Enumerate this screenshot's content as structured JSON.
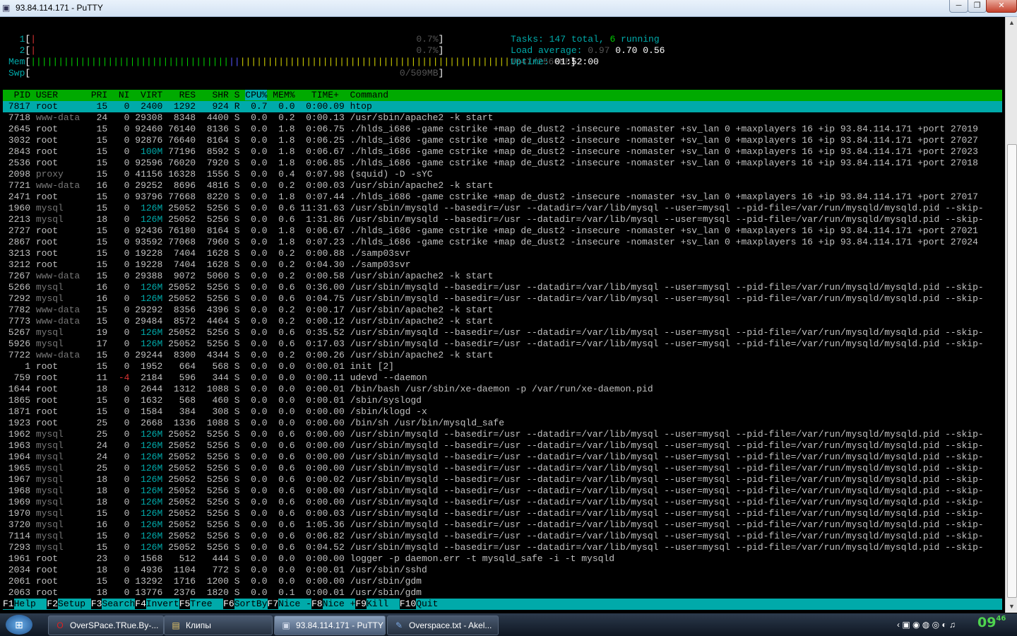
{
  "window": {
    "title": "93.84.114.171 - PuTTY",
    "min": "─",
    "max": "❐",
    "close": "✕"
  },
  "colors": {
    "bg": "#000000",
    "fg": "#c0c0c0",
    "cyan": "#00aaaa",
    "green": "#00c000",
    "bright_green": "#00cc00",
    "white": "#ffffff",
    "yellow": "#d0d000",
    "blue": "#5555ff",
    "red": "#dd3333",
    "grey": "#777777",
    "header_bg": "#00aa00",
    "select_bg": "#00aaaa",
    "fkey_bg": "#00aaaa"
  },
  "meters": [
    {
      "label": "1",
      "bar": "|",
      "value": "0.7%"
    },
    {
      "label": "2",
      "bar": "|",
      "value": "0.7%"
    },
    {
      "label": "Mem",
      "bar": "|||||||||||||||||||||||||||||||||||||||||||||||||||||||||||||||||||||||||||||||||||||||",
      "value": "1047/2560MB"
    },
    {
      "label": "Swp",
      "bar": "",
      "value": "0/509MB"
    }
  ],
  "tasks": {
    "label": "Tasks: ",
    "total": "147",
    "total_suffix": " total, ",
    "running": "6",
    "running_suffix": " running"
  },
  "load": {
    "label": "Load average: ",
    "one": "0.97",
    "five": "0.70",
    "fifteen": "0.56"
  },
  "uptime": {
    "label": "Uptime: ",
    "value": "01:52:00"
  },
  "table_header": "  PID USER      PRI  NI  VIRT   RES   SHR S CPU% MEM%   TIME+  Command",
  "sort_column": "CPU%",
  "processes": [
    {
      "pid": "7817",
      "user": "root",
      "pri": "15",
      "ni": "0",
      "virt": "2400",
      "res": "1292",
      "shr": "924",
      "s": "R",
      "cpu": "0.7",
      "mem": "0.0",
      "time": "0:00.09",
      "cmd": "htop",
      "selected": true
    },
    {
      "pid": "7718",
      "user": "www-data",
      "pri": "24",
      "ni": "0",
      "virt": "29308",
      "res": "8348",
      "shr": "4400",
      "s": "S",
      "cpu": "0.0",
      "mem": "0.2",
      "time": "0:00.13",
      "cmd": "/usr/sbin/apache2 -k start"
    },
    {
      "pid": "2645",
      "user": "root",
      "pri": "15",
      "ni": "0",
      "virt": "92460",
      "res": "76140",
      "shr": "8136",
      "s": "S",
      "cpu": "0.0",
      "mem": "1.8",
      "time": "0:06.75",
      "cmd": "./hlds_i686 -game cstrike +map de_dust2 -insecure -nomaster +sv_lan 0 +maxplayers 16 +ip 93.84.114.171 +port 27019"
    },
    {
      "pid": "3032",
      "user": "root",
      "pri": "15",
      "ni": "0",
      "virt": "92876",
      "res": "76640",
      "shr": "8164",
      "s": "S",
      "cpu": "0.0",
      "mem": "1.8",
      "time": "0:06.25",
      "cmd": "./hlds_i686 -game cstrike +map de_dust2 -insecure -nomaster +sv_lan 0 +maxplayers 16 +ip 93.84.114.171 +port 27027"
    },
    {
      "pid": "2843",
      "user": "root",
      "pri": "15",
      "ni": "0",
      "virt": "100M",
      "res": "77196",
      "shr": "8592",
      "s": "S",
      "cpu": "0.0",
      "mem": "1.8",
      "time": "0:06.67",
      "cmd": "./hlds_i686 -game cstrike +map de_dust2 -insecure -nomaster +sv_lan 0 +maxplayers 16 +ip 93.84.114.171 +port 27023"
    },
    {
      "pid": "2536",
      "user": "root",
      "pri": "15",
      "ni": "0",
      "virt": "92596",
      "res": "76020",
      "shr": "7920",
      "s": "S",
      "cpu": "0.0",
      "mem": "1.8",
      "time": "0:06.85",
      "cmd": "./hlds_i686 -game cstrike +map de_dust2 -insecure -nomaster +sv_lan 0 +maxplayers 16 +ip 93.84.114.171 +port 27018"
    },
    {
      "pid": "2098",
      "user": "proxy",
      "pri": "15",
      "ni": "0",
      "virt": "41156",
      "res": "16328",
      "shr": "1556",
      "s": "S",
      "cpu": "0.0",
      "mem": "0.4",
      "time": "0:07.98",
      "cmd": "(squid) -D -sYC"
    },
    {
      "pid": "7721",
      "user": "www-data",
      "pri": "16",
      "ni": "0",
      "virt": "29252",
      "res": "8696",
      "shr": "4816",
      "s": "S",
      "cpu": "0.0",
      "mem": "0.2",
      "time": "0:00.03",
      "cmd": "/usr/sbin/apache2 -k start"
    },
    {
      "pid": "2471",
      "user": "root",
      "pri": "15",
      "ni": "0",
      "virt": "93796",
      "res": "77668",
      "shr": "8220",
      "s": "S",
      "cpu": "0.0",
      "mem": "1.8",
      "time": "0:07.44",
      "cmd": "./hlds_i686 -game cstrike +map de_dust2 -insecure -nomaster +sv_lan 0 +maxplayers 16 +ip 93.84.114.171 +port 27017"
    },
    {
      "pid": "1960",
      "user": "mysql",
      "pri": "15",
      "ni": "0",
      "virt": "126M",
      "res": "25052",
      "shr": "5256",
      "s": "S",
      "cpu": "0.0",
      "mem": "0.6",
      "time": "11:31.63",
      "cmd": "/usr/sbin/mysqld --basedir=/usr --datadir=/var/lib/mysql --user=mysql --pid-file=/var/run/mysqld/mysqld.pid --skip-"
    },
    {
      "pid": "2213",
      "user": "mysql",
      "pri": "18",
      "ni": "0",
      "virt": "126M",
      "res": "25052",
      "shr": "5256",
      "s": "S",
      "cpu": "0.0",
      "mem": "0.6",
      "time": "1:31.86",
      "cmd": "/usr/sbin/mysqld --basedir=/usr --datadir=/var/lib/mysql --user=mysql --pid-file=/var/run/mysqld/mysqld.pid --skip-"
    },
    {
      "pid": "2727",
      "user": "root",
      "pri": "15",
      "ni": "0",
      "virt": "92436",
      "res": "76180",
      "shr": "8164",
      "s": "S",
      "cpu": "0.0",
      "mem": "1.8",
      "time": "0:06.67",
      "cmd": "./hlds_i686 -game cstrike +map de_dust2 -insecure -nomaster +sv_lan 0 +maxplayers 16 +ip 93.84.114.171 +port 27021"
    },
    {
      "pid": "2867",
      "user": "root",
      "pri": "15",
      "ni": "0",
      "virt": "93592",
      "res": "77068",
      "shr": "7960",
      "s": "S",
      "cpu": "0.0",
      "mem": "1.8",
      "time": "0:07.23",
      "cmd": "./hlds_i686 -game cstrike +map de_dust2 -insecure -nomaster +sv_lan 0 +maxplayers 16 +ip 93.84.114.171 +port 27024"
    },
    {
      "pid": "3213",
      "user": "root",
      "pri": "15",
      "ni": "0",
      "virt": "19228",
      "res": "7404",
      "shr": "1628",
      "s": "S",
      "cpu": "0.0",
      "mem": "0.2",
      "time": "0:00.88",
      "cmd": "./samp03svr"
    },
    {
      "pid": "3212",
      "user": "root",
      "pri": "15",
      "ni": "0",
      "virt": "19228",
      "res": "7404",
      "shr": "1628",
      "s": "S",
      "cpu": "0.0",
      "mem": "0.2",
      "time": "0:04.30",
      "cmd": "./samp03svr"
    },
    {
      "pid": "7267",
      "user": "www-data",
      "pri": "15",
      "ni": "0",
      "virt": "29388",
      "res": "9072",
      "shr": "5060",
      "s": "S",
      "cpu": "0.0",
      "mem": "0.2",
      "time": "0:00.58",
      "cmd": "/usr/sbin/apache2 -k start"
    },
    {
      "pid": "5266",
      "user": "mysql",
      "pri": "16",
      "ni": "0",
      "virt": "126M",
      "res": "25052",
      "shr": "5256",
      "s": "S",
      "cpu": "0.0",
      "mem": "0.6",
      "time": "0:36.00",
      "cmd": "/usr/sbin/mysqld --basedir=/usr --datadir=/var/lib/mysql --user=mysql --pid-file=/var/run/mysqld/mysqld.pid --skip-"
    },
    {
      "pid": "7292",
      "user": "mysql",
      "pri": "16",
      "ni": "0",
      "virt": "126M",
      "res": "25052",
      "shr": "5256",
      "s": "S",
      "cpu": "0.0",
      "mem": "0.6",
      "time": "0:04.75",
      "cmd": "/usr/sbin/mysqld --basedir=/usr --datadir=/var/lib/mysql --user=mysql --pid-file=/var/run/mysqld/mysqld.pid --skip-"
    },
    {
      "pid": "7782",
      "user": "www-data",
      "pri": "15",
      "ni": "0",
      "virt": "29292",
      "res": "8356",
      "shr": "4396",
      "s": "S",
      "cpu": "0.0",
      "mem": "0.2",
      "time": "0:00.17",
      "cmd": "/usr/sbin/apache2 -k start"
    },
    {
      "pid": "7773",
      "user": "www-data",
      "pri": "15",
      "ni": "0",
      "virt": "29484",
      "res": "8572",
      "shr": "4464",
      "s": "S",
      "cpu": "0.0",
      "mem": "0.2",
      "time": "0:00.12",
      "cmd": "/usr/sbin/apache2 -k start"
    },
    {
      "pid": "5267",
      "user": "mysql",
      "pri": "19",
      "ni": "0",
      "virt": "126M",
      "res": "25052",
      "shr": "5256",
      "s": "S",
      "cpu": "0.0",
      "mem": "0.6",
      "time": "0:35.52",
      "cmd": "/usr/sbin/mysqld --basedir=/usr --datadir=/var/lib/mysql --user=mysql --pid-file=/var/run/mysqld/mysqld.pid --skip-"
    },
    {
      "pid": "5926",
      "user": "mysql",
      "pri": "17",
      "ni": "0",
      "virt": "126M",
      "res": "25052",
      "shr": "5256",
      "s": "S",
      "cpu": "0.0",
      "mem": "0.6",
      "time": "0:17.03",
      "cmd": "/usr/sbin/mysqld --basedir=/usr --datadir=/var/lib/mysql --user=mysql --pid-file=/var/run/mysqld/mysqld.pid --skip-"
    },
    {
      "pid": "7722",
      "user": "www-data",
      "pri": "15",
      "ni": "0",
      "virt": "29244",
      "res": "8300",
      "shr": "4344",
      "s": "S",
      "cpu": "0.0",
      "mem": "0.2",
      "time": "0:00.26",
      "cmd": "/usr/sbin/apache2 -k start"
    },
    {
      "pid": "1",
      "user": "root",
      "pri": "15",
      "ni": "0",
      "virt": "1952",
      "res": "664",
      "shr": "568",
      "s": "S",
      "cpu": "0.0",
      "mem": "0.0",
      "time": "0:00.01",
      "cmd": "init [2]"
    },
    {
      "pid": "759",
      "user": "root",
      "pri": "11",
      "ni": "-4",
      "virt": "2184",
      "res": "596",
      "shr": "344",
      "s": "S",
      "cpu": "0.0",
      "mem": "0.0",
      "time": "0:00.11",
      "cmd": "udevd --daemon"
    },
    {
      "pid": "1644",
      "user": "root",
      "pri": "18",
      "ni": "0",
      "virt": "2644",
      "res": "1312",
      "shr": "1088",
      "s": "S",
      "cpu": "0.0",
      "mem": "0.0",
      "time": "0:00.01",
      "cmd": "/bin/bash /usr/sbin/xe-daemon -p /var/run/xe-daemon.pid"
    },
    {
      "pid": "1865",
      "user": "root",
      "pri": "15",
      "ni": "0",
      "virt": "1632",
      "res": "568",
      "shr": "460",
      "s": "S",
      "cpu": "0.0",
      "mem": "0.0",
      "time": "0:00.01",
      "cmd": "/sbin/syslogd"
    },
    {
      "pid": "1871",
      "user": "root",
      "pri": "15",
      "ni": "0",
      "virt": "1584",
      "res": "384",
      "shr": "308",
      "s": "S",
      "cpu": "0.0",
      "mem": "0.0",
      "time": "0:00.00",
      "cmd": "/sbin/klogd -x"
    },
    {
      "pid": "1923",
      "user": "root",
      "pri": "25",
      "ni": "0",
      "virt": "2668",
      "res": "1336",
      "shr": "1088",
      "s": "S",
      "cpu": "0.0",
      "mem": "0.0",
      "time": "0:00.00",
      "cmd": "/bin/sh /usr/bin/mysqld_safe"
    },
    {
      "pid": "1962",
      "user": "mysql",
      "pri": "25",
      "ni": "0",
      "virt": "126M",
      "res": "25052",
      "shr": "5256",
      "s": "S",
      "cpu": "0.0",
      "mem": "0.6",
      "time": "0:00.00",
      "cmd": "/usr/sbin/mysqld --basedir=/usr --datadir=/var/lib/mysql --user=mysql --pid-file=/var/run/mysqld/mysqld.pid --skip-"
    },
    {
      "pid": "1963",
      "user": "mysql",
      "pri": "24",
      "ni": "0",
      "virt": "126M",
      "res": "25052",
      "shr": "5256",
      "s": "S",
      "cpu": "0.0",
      "mem": "0.6",
      "time": "0:00.00",
      "cmd": "/usr/sbin/mysqld --basedir=/usr --datadir=/var/lib/mysql --user=mysql --pid-file=/var/run/mysqld/mysqld.pid --skip-"
    },
    {
      "pid": "1964",
      "user": "mysql",
      "pri": "24",
      "ni": "0",
      "virt": "126M",
      "res": "25052",
      "shr": "5256",
      "s": "S",
      "cpu": "0.0",
      "mem": "0.6",
      "time": "0:00.00",
      "cmd": "/usr/sbin/mysqld --basedir=/usr --datadir=/var/lib/mysql --user=mysql --pid-file=/var/run/mysqld/mysqld.pid --skip-"
    },
    {
      "pid": "1965",
      "user": "mysql",
      "pri": "25",
      "ni": "0",
      "virt": "126M",
      "res": "25052",
      "shr": "5256",
      "s": "S",
      "cpu": "0.0",
      "mem": "0.6",
      "time": "0:00.00",
      "cmd": "/usr/sbin/mysqld --basedir=/usr --datadir=/var/lib/mysql --user=mysql --pid-file=/var/run/mysqld/mysqld.pid --skip-"
    },
    {
      "pid": "1967",
      "user": "mysql",
      "pri": "18",
      "ni": "0",
      "virt": "126M",
      "res": "25052",
      "shr": "5256",
      "s": "S",
      "cpu": "0.0",
      "mem": "0.6",
      "time": "0:00.02",
      "cmd": "/usr/sbin/mysqld --basedir=/usr --datadir=/var/lib/mysql --user=mysql --pid-file=/var/run/mysqld/mysqld.pid --skip-"
    },
    {
      "pid": "1968",
      "user": "mysql",
      "pri": "18",
      "ni": "0",
      "virt": "126M",
      "res": "25052",
      "shr": "5256",
      "s": "S",
      "cpu": "0.0",
      "mem": "0.6",
      "time": "0:00.00",
      "cmd": "/usr/sbin/mysqld --basedir=/usr --datadir=/var/lib/mysql --user=mysql --pid-file=/var/run/mysqld/mysqld.pid --skip-"
    },
    {
      "pid": "1969",
      "user": "mysql",
      "pri": "18",
      "ni": "0",
      "virt": "126M",
      "res": "25052",
      "shr": "5256",
      "s": "S",
      "cpu": "0.0",
      "mem": "0.6",
      "time": "0:00.00",
      "cmd": "/usr/sbin/mysqld --basedir=/usr --datadir=/var/lib/mysql --user=mysql --pid-file=/var/run/mysqld/mysqld.pid --skip-"
    },
    {
      "pid": "1970",
      "user": "mysql",
      "pri": "15",
      "ni": "0",
      "virt": "126M",
      "res": "25052",
      "shr": "5256",
      "s": "S",
      "cpu": "0.0",
      "mem": "0.6",
      "time": "0:00.03",
      "cmd": "/usr/sbin/mysqld --basedir=/usr --datadir=/var/lib/mysql --user=mysql --pid-file=/var/run/mysqld/mysqld.pid --skip-"
    },
    {
      "pid": "3720",
      "user": "mysql",
      "pri": "16",
      "ni": "0",
      "virt": "126M",
      "res": "25052",
      "shr": "5256",
      "s": "S",
      "cpu": "0.0",
      "mem": "0.6",
      "time": "1:05.36",
      "cmd": "/usr/sbin/mysqld --basedir=/usr --datadir=/var/lib/mysql --user=mysql --pid-file=/var/run/mysqld/mysqld.pid --skip-"
    },
    {
      "pid": "7114",
      "user": "mysql",
      "pri": "15",
      "ni": "0",
      "virt": "126M",
      "res": "25052",
      "shr": "5256",
      "s": "S",
      "cpu": "0.0",
      "mem": "0.6",
      "time": "0:06.82",
      "cmd": "/usr/sbin/mysqld --basedir=/usr --datadir=/var/lib/mysql --user=mysql --pid-file=/var/run/mysqld/mysqld.pid --skip-"
    },
    {
      "pid": "7293",
      "user": "mysql",
      "pri": "15",
      "ni": "0",
      "virt": "126M",
      "res": "25052",
      "shr": "5256",
      "s": "S",
      "cpu": "0.0",
      "mem": "0.6",
      "time": "0:04.52",
      "cmd": "/usr/sbin/mysqld --basedir=/usr --datadir=/var/lib/mysql --user=mysql --pid-file=/var/run/mysqld/mysqld.pid --skip-"
    },
    {
      "pid": "1961",
      "user": "root",
      "pri": "23",
      "ni": "0",
      "virt": "1568",
      "res": "512",
      "shr": "444",
      "s": "S",
      "cpu": "0.0",
      "mem": "0.0",
      "time": "0:00.00",
      "cmd": "logger -p daemon.err -t mysqld_safe -i -t mysqld"
    },
    {
      "pid": "2034",
      "user": "root",
      "pri": "18",
      "ni": "0",
      "virt": "4936",
      "res": "1104",
      "shr": "772",
      "s": "S",
      "cpu": "0.0",
      "mem": "0.0",
      "time": "0:00.01",
      "cmd": "/usr/sbin/sshd"
    },
    {
      "pid": "2061",
      "user": "root",
      "pri": "15",
      "ni": "0",
      "virt": "13292",
      "res": "1716",
      "shr": "1200",
      "s": "S",
      "cpu": "0.0",
      "mem": "0.0",
      "time": "0:00.00",
      "cmd": "/usr/sbin/gdm"
    },
    {
      "pid": "2063",
      "user": "root",
      "pri": "18",
      "ni": "0",
      "virt": "13776",
      "res": "2376",
      "shr": "1820",
      "s": "S",
      "cpu": "0.0",
      "mem": "0.1",
      "time": "0:00.01",
      "cmd": "/usr/sbin/gdm"
    }
  ],
  "fkeys": [
    {
      "key": "F1",
      "label": "Help  "
    },
    {
      "key": "F2",
      "label": "Setup "
    },
    {
      "key": "F3",
      "label": "Search"
    },
    {
      "key": "F4",
      "label": "Invert"
    },
    {
      "key": "F5",
      "label": "Tree  "
    },
    {
      "key": "F6",
      "label": "SortBy"
    },
    {
      "key": "F7",
      "label": "Nice -"
    },
    {
      "key": "F8",
      "label": "Nice +"
    },
    {
      "key": "F9",
      "label": "Kill  "
    },
    {
      "key": "F10",
      "label": "Quit"
    }
  ],
  "taskbar": {
    "start_icon": "windows-orb",
    "items": [
      {
        "label": "OverSPace.TRue.By-...",
        "icon": "opera-icon",
        "active": false
      },
      {
        "label": "Клипы",
        "icon": "folder-icon",
        "active": false
      },
      {
        "label": "93.84.114.171 - PuTTY",
        "icon": "putty-icon",
        "active": true
      },
      {
        "label": "Overspace.txt - Akel...",
        "icon": "akelpad-icon",
        "active": false
      }
    ],
    "clock": {
      "hour": "09",
      "minute": "46"
    }
  }
}
